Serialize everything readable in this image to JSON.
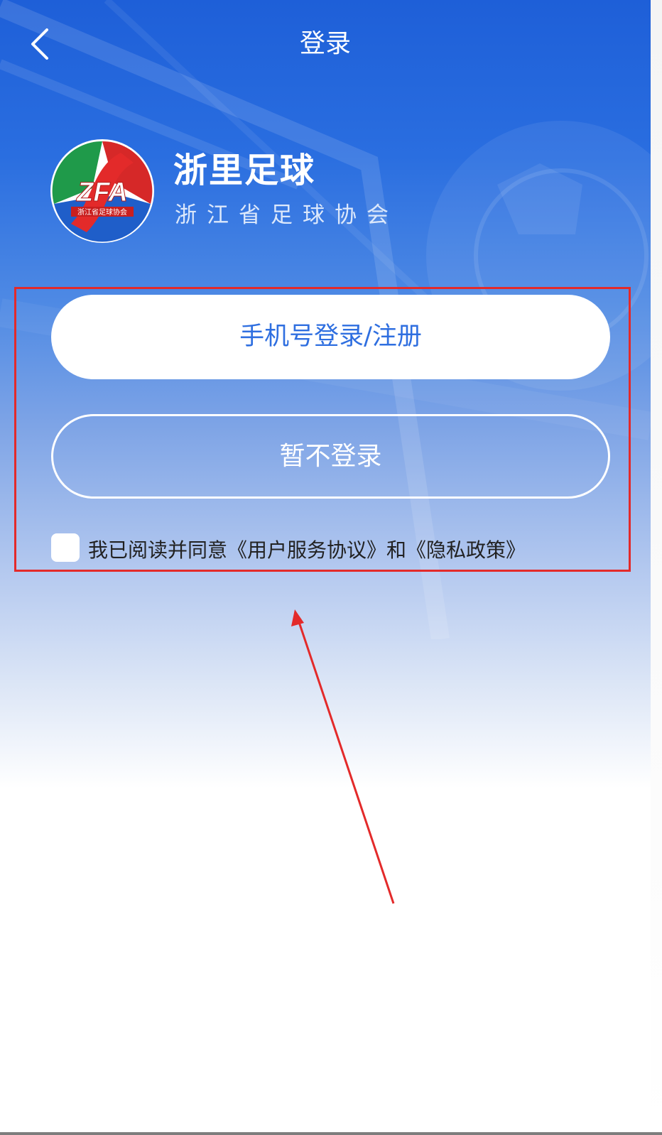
{
  "header": {
    "title": "登录",
    "back_icon": "chevron-left-icon"
  },
  "brand": {
    "logo_icon": "zfa-logo",
    "logo_text": "ZFA",
    "logo_subtext": "浙江省足球协会",
    "name": "浙里足球",
    "subtitle": "浙江省足球协会"
  },
  "actions": {
    "phone_login_label": "手机号登录/注册",
    "skip_login_label": "暂不登录"
  },
  "agreement": {
    "checked": false,
    "prefix": "我已阅读并同意",
    "user_agreement": "《用户服务协议》",
    "conjunction": "和",
    "privacy_policy": "《隐私政策》"
  },
  "colors": {
    "primary_blue": "#2f6fe0",
    "annotation_red": "#e32a2a",
    "background_top": "#1e5fd8"
  }
}
